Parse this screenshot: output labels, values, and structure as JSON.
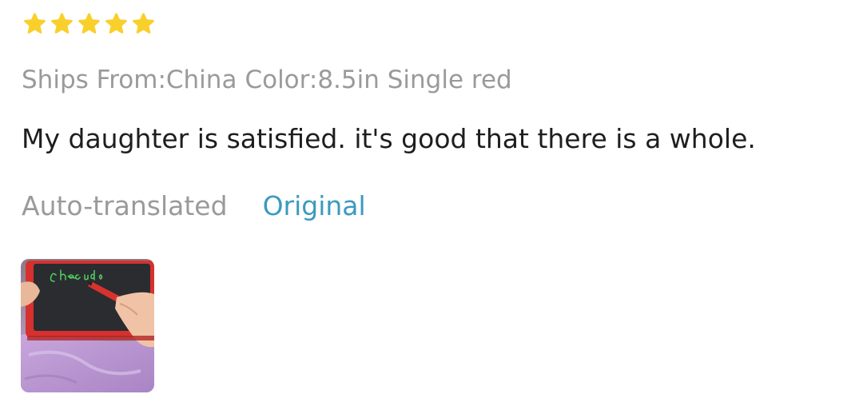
{
  "review": {
    "rating": 5,
    "rating_max": 5,
    "star_color": "#F9CF2B",
    "sku_attributes": [
      {
        "label": "Ships From",
        "value": "China"
      },
      {
        "label": "Color",
        "value": "8.5in Single red"
      }
    ],
    "comment": "My daughter is satisfied. it's good that there is a whole.",
    "translation": {
      "status_label": "Auto-translated",
      "toggle_label": "Original",
      "link_color": "#3A9BBD"
    },
    "photos": [
      {
        "icon": "review-photo-writing-tablet"
      }
    ]
  }
}
